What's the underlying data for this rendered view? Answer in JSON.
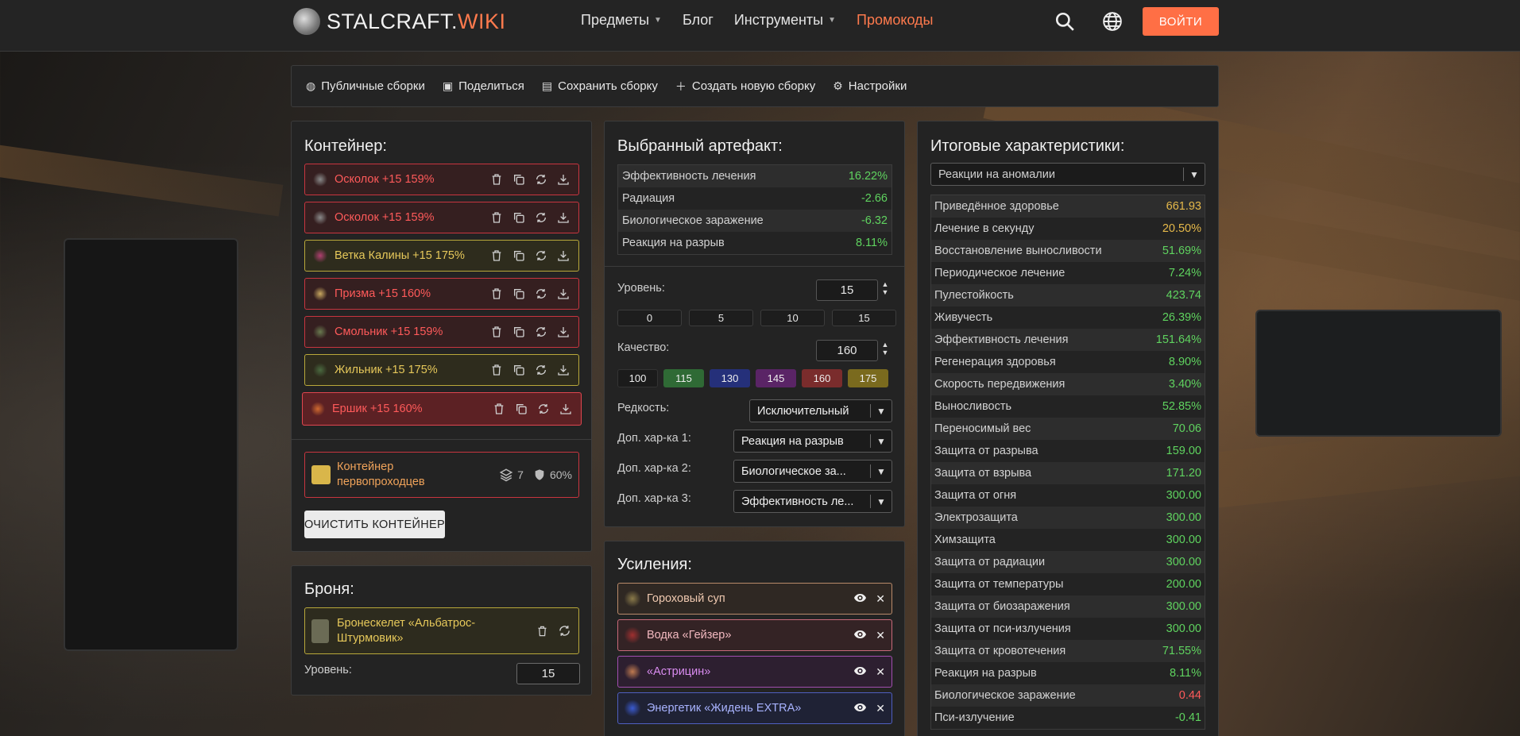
{
  "brand": {
    "name": "STALCRAFT.",
    "suffix": "WIKI"
  },
  "nav": {
    "items": [
      {
        "label": "Предметы",
        "caret": true
      },
      {
        "label": "Блог",
        "caret": false
      },
      {
        "label": "Инструменты",
        "caret": true
      },
      {
        "label": "Промокоды",
        "caret": false,
        "accent": true
      }
    ],
    "login": "ВОЙТИ"
  },
  "toolbar": {
    "public": "Публичные сборки",
    "share": "Поделиться",
    "save": "Сохранить сборку",
    "create": "Создать новую сборку",
    "settings": "Настройки"
  },
  "container": {
    "title": "Контейнер:",
    "artifacts": [
      {
        "name": "Осколок +15 159%",
        "color": "red"
      },
      {
        "name": "Осколок +15 159%",
        "color": "red"
      },
      {
        "name": "Ветка Калины +15 175%",
        "color": "gold"
      },
      {
        "name": "Призма +15 160%",
        "color": "red"
      },
      {
        "name": "Смольник +15 159%",
        "color": "red"
      },
      {
        "name": "Жильник +15 175%",
        "color": "gold"
      },
      {
        "name": "Ершик +15 160%",
        "color": "red",
        "selected": true
      }
    ],
    "box_name_1": "Контейнер",
    "box_name_2": "первопроходцев",
    "slots": "7",
    "protection": "60%",
    "clear": "ОЧИСТИТЬ КОНТЕЙНЕР"
  },
  "armor": {
    "title": "Броня:",
    "name_1": "Бронескелет «Альбатрос-",
    "name_2": "Штурмовик»",
    "level_label": "Уровень:",
    "level": "15"
  },
  "selected": {
    "title": "Выбранный артефакт:",
    "stats": [
      {
        "label": "Эффективность лечения",
        "value": "16.22%",
        "tone": "pos"
      },
      {
        "label": "Радиация",
        "value": "-2.66",
        "tone": "pos"
      },
      {
        "label": "Биологическое заражение",
        "value": "-6.32",
        "tone": "pos"
      },
      {
        "label": "Реакция на разрыв",
        "value": "8.11%",
        "tone": "pos"
      }
    ],
    "level_label": "Уровень:",
    "level": "15",
    "level_presets": [
      "0",
      "5",
      "10",
      "15"
    ],
    "quality_label": "Качество:",
    "quality": "160",
    "quality_presets": [
      {
        "label": "100",
        "color": "#1b1b1b"
      },
      {
        "label": "115",
        "color": "#2f6a35"
      },
      {
        "label": "130",
        "color": "#25307a"
      },
      {
        "label": "145",
        "color": "#5a2466"
      },
      {
        "label": "160",
        "color": "#7a2c2c"
      },
      {
        "label": "175",
        "color": "#7a6a1e"
      }
    ],
    "rarity_label": "Редкость:",
    "rarity": "Исключительный",
    "extra1_label": "Доп. хар-ка 1:",
    "extra1": "Реакция на разрыв",
    "extra2_label": "Доп. хар-ка 2:",
    "extra2": "Биологическое за...",
    "extra3_label": "Доп. хар-ка 3:",
    "extra3": "Эффективность ле..."
  },
  "boosts": {
    "title": "Усиления:",
    "items": [
      {
        "name": "Гороховый суп",
        "color": "orange"
      },
      {
        "name": "Водка «Гейзер»",
        "color": "red"
      },
      {
        "name": "«Астрицин»",
        "color": "purple"
      },
      {
        "name": "Энергетик «Жидень EXTRA»",
        "color": "blue"
      }
    ]
  },
  "result": {
    "title": "Итоговые характеристики:",
    "filter": "Реакции на аномалии",
    "stats": [
      {
        "label": "Приведённое здоровье",
        "value": "661.93",
        "tone": "gold"
      },
      {
        "label": "Лечение в секунду",
        "value": "20.50%",
        "tone": "gold"
      },
      {
        "label": "Восстановление выносливости",
        "value": "51.69%",
        "tone": "pos"
      },
      {
        "label": "Периодическое лечение",
        "value": "7.24%",
        "tone": "pos"
      },
      {
        "label": "Пулестойкость",
        "value": "423.74",
        "tone": "pos"
      },
      {
        "label": "Живучесть",
        "value": "26.39%",
        "tone": "pos"
      },
      {
        "label": "Эффективность лечения",
        "value": "151.64%",
        "tone": "pos"
      },
      {
        "label": "Регенерация здоровья",
        "value": "8.90%",
        "tone": "pos"
      },
      {
        "label": "Скорость передвижения",
        "value": "3.40%",
        "tone": "pos"
      },
      {
        "label": "Выносливость",
        "value": "52.85%",
        "tone": "pos"
      },
      {
        "label": "Переносимый вес",
        "value": "70.06",
        "tone": "pos"
      },
      {
        "label": "Защита от разрыва",
        "value": "159.00",
        "tone": "pos"
      },
      {
        "label": "Защита от взрыва",
        "value": "171.20",
        "tone": "pos"
      },
      {
        "label": "Защита от огня",
        "value": "300.00",
        "tone": "pos"
      },
      {
        "label": "Электрозащита",
        "value": "300.00",
        "tone": "pos"
      },
      {
        "label": "Химзащита",
        "value": "300.00",
        "tone": "pos"
      },
      {
        "label": "Защита от радиации",
        "value": "300.00",
        "tone": "pos"
      },
      {
        "label": "Защита от температуры",
        "value": "200.00",
        "tone": "pos"
      },
      {
        "label": "Защита от биозаражения",
        "value": "300.00",
        "tone": "pos"
      },
      {
        "label": "Защита от пси-излучения",
        "value": "300.00",
        "tone": "pos"
      },
      {
        "label": "Защита от кровотечения",
        "value": "71.55%",
        "tone": "pos"
      },
      {
        "label": "Реакция на разрыв",
        "value": "8.11%",
        "tone": "pos"
      },
      {
        "label": "Биологическое заражение",
        "value": "0.44",
        "tone": "red"
      },
      {
        "label": "Пси-излучение",
        "value": "-0.41",
        "tone": "pos"
      }
    ]
  }
}
